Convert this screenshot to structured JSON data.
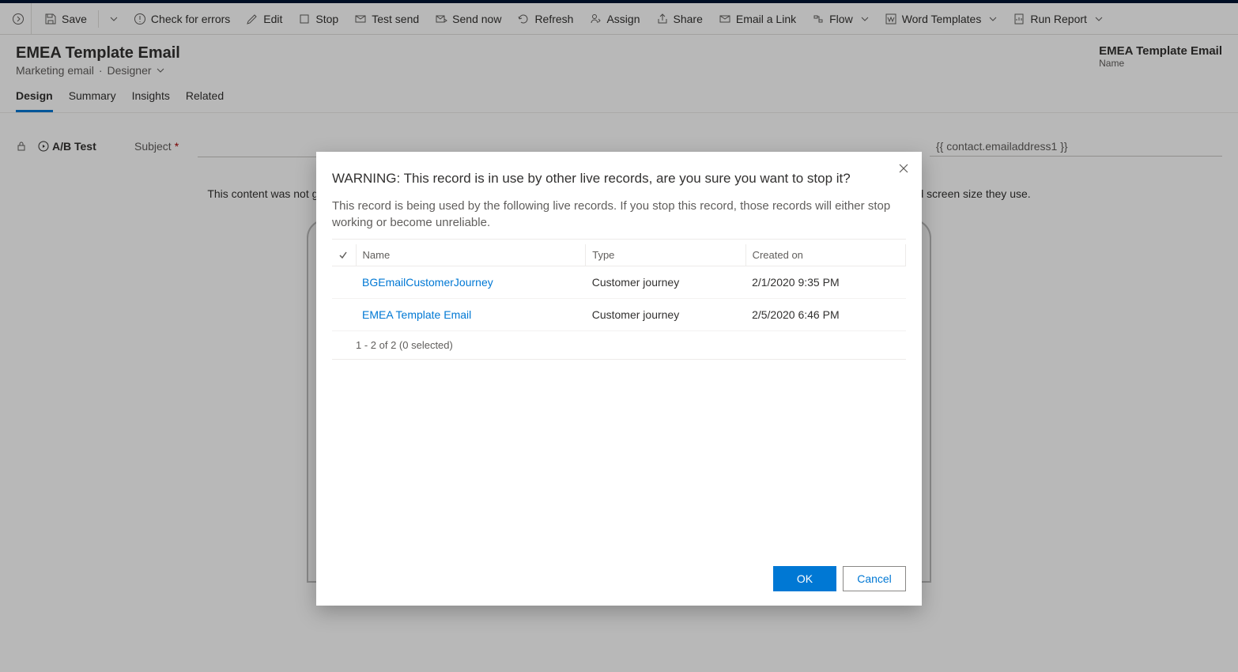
{
  "commandbar": {
    "save": "Save",
    "check": "Check for errors",
    "edit": "Edit",
    "stop": "Stop",
    "testsend": "Test send",
    "sendnow": "Send now",
    "refresh": "Refresh",
    "assign": "Assign",
    "share": "Share",
    "emaillink": "Email a Link",
    "flow": "Flow",
    "wordtemplates": "Word Templates",
    "runreport": "Run Report"
  },
  "header": {
    "title": "EMEA Template Email",
    "subtitle_a": "Marketing email",
    "subtitle_b": "Designer",
    "right_value": "EMEA Template Email",
    "right_label": "Name"
  },
  "tabs": {
    "design": "Design",
    "summary": "Summary",
    "insights": "Insights",
    "related": "Related"
  },
  "form": {
    "abtest": "A/B Test",
    "subject": "Subject",
    "to_value": "{{ contact.emailaddress1 }}"
  },
  "preview_msg": "This content was not generated in the designer so we can't show a preview. Your contacts will see it correctly, depending on which email client and screen size they use.",
  "dialog": {
    "title": "WARNING: This record is in use by other live records, are you sure you want to stop it?",
    "desc": "This record is being used by the following live records. If you stop this record, those records will either stop working or become unreliable.",
    "col_name": "Name",
    "col_type": "Type",
    "col_created": "Created on",
    "rows": [
      {
        "name": "BGEmailCustomerJourney",
        "type": "Customer journey",
        "created": "2/1/2020 9:35 PM"
      },
      {
        "name": "EMEA Template Email",
        "type": "Customer journey",
        "created": "2/5/2020 6:46 PM"
      }
    ],
    "pager": "1 - 2 of 2 (0 selected)",
    "ok": "OK",
    "cancel": "Cancel"
  }
}
